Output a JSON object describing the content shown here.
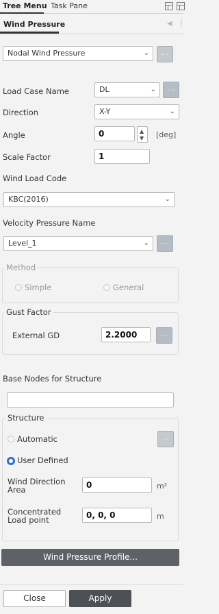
{
  "tabs": {
    "tree_menu": "Tree Menu",
    "task_pane": "Task Pane"
  },
  "header": {
    "title": "Wind Pressure"
  },
  "type_select": {
    "value": "Nodal Wind Pressure"
  },
  "load_case": {
    "label": "Load Case Name",
    "value": "DL"
  },
  "direction": {
    "label": "Direction",
    "value": "X-Y"
  },
  "angle": {
    "label": "Angle",
    "value": "0",
    "unit": "[deg]"
  },
  "scale_factor": {
    "label": "Scale Factor",
    "value": "1"
  },
  "wind_load_code": {
    "label": "Wind Load Code",
    "value": "KBC(2016)"
  },
  "velocity_pressure": {
    "label": "Velocity Pressure Name",
    "value": "Level_1"
  },
  "method": {
    "legend": "Method",
    "simple": "Simple",
    "general": "General"
  },
  "gust_factor": {
    "legend": "Gust Factor",
    "label": "External GD",
    "value": "2.2000"
  },
  "base_nodes": {
    "label": "Base Nodes for Structure",
    "value": ""
  },
  "structure": {
    "legend": "Structure",
    "automatic": "Automatic",
    "user_defined": "User Defined",
    "area_label_1": "Wind Direction",
    "area_label_2": "Area",
    "area_value": "0",
    "area_unit": "m²",
    "load_point_label_1": "Concentrated",
    "load_point_label_2": "Load point",
    "load_point_value": "0, 0, 0",
    "load_point_unit": "m"
  },
  "dots": "...",
  "profile_button": "Wind Pressure Profile...",
  "footer": {
    "close": "Close",
    "apply": "Apply"
  }
}
